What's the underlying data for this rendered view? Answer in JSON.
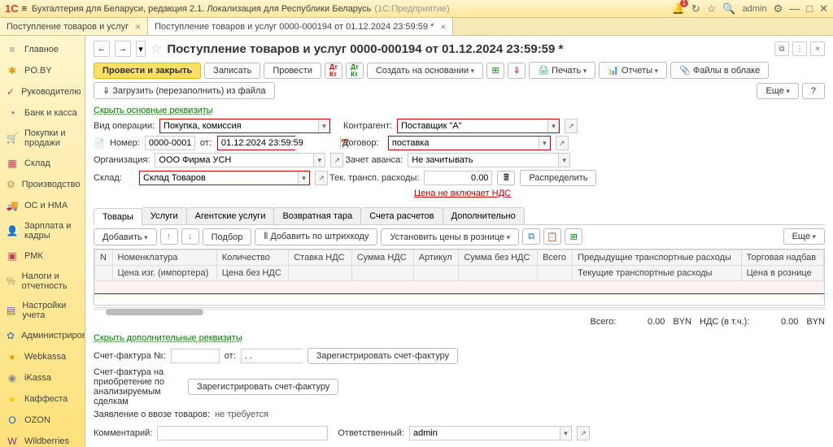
{
  "titlebar": {
    "logo": "1С",
    "menu": "≡",
    "title": "Бухгалтерия для Беларуси, редакция 2.1. Локализация для Республики Беларусь",
    "app": "(1С:Предприятие)",
    "user": "admin"
  },
  "tabs": [
    {
      "label": "Поступление товаров и услуг",
      "active": false
    },
    {
      "label": "Поступление товаров и услуг 0000-000194 от 01.12.2024 23:59:59 *",
      "active": true
    }
  ],
  "sidebar": [
    {
      "icon": "≡",
      "label": "Главное",
      "color": "#888"
    },
    {
      "icon": "✱",
      "label": "PO.BY",
      "color": "#e89b00"
    },
    {
      "icon": "✓",
      "label": "Руководителю",
      "color": "#c4395f"
    },
    {
      "icon": "◔",
      "label": "Банк и касса",
      "color": "#c4395f"
    },
    {
      "icon": "🛒",
      "label": "Покупки и продажи",
      "color": "#c4395f"
    },
    {
      "icon": "▦",
      "label": "Склад",
      "color": "#c4395f"
    },
    {
      "icon": "⚙",
      "label": "Производство",
      "color": "#b8935c"
    },
    {
      "icon": "🚚",
      "label": "ОС и НМА",
      "color": "#5c8ab8"
    },
    {
      "icon": "👤",
      "label": "Зарплата и кадры",
      "color": "#b8935c"
    },
    {
      "icon": "▣",
      "label": "РМК",
      "color": "#c4395f"
    },
    {
      "icon": "%",
      "label": "Налоги и отчетность",
      "color": "#b8935c"
    },
    {
      "icon": "▤",
      "label": "Настройки учета",
      "color": "#6a5cb8"
    },
    {
      "icon": "✿",
      "label": "Администрирование",
      "color": "#5c8ab8"
    },
    {
      "icon": "●",
      "label": "Webkassa",
      "color": "#e89b00"
    },
    {
      "icon": "◉",
      "label": "iKassa",
      "color": "#888"
    },
    {
      "icon": "●",
      "label": "Каффеста",
      "color": "#f0d000"
    },
    {
      "icon": "O",
      "label": "OZON",
      "color": "#0066cc"
    },
    {
      "icon": "W",
      "label": "Wildberries",
      "color": "#7b2d8e"
    }
  ],
  "page": {
    "title": "Поступление товаров и услуг 0000-000194 от 01.12.2024 23:59:59 *"
  },
  "toolbar": {
    "post_close": "Провести и закрыть",
    "write": "Записать",
    "post": "Провести",
    "create_based": "Создать на основании",
    "print": "Печать",
    "reports": "Отчеты",
    "cloud": "Файлы в облаке",
    "load": "Загрузить (перезаполнить) из файла",
    "more": "Еще",
    "help": "?"
  },
  "link_hide": "Скрыть основные реквизиты",
  "form": {
    "op_type_label": "Вид операции:",
    "op_type": "Покупка, комиссия",
    "counterparty_label": "Контрагент:",
    "counterparty": "Поставщик \"А\"",
    "number_label": "Номер:",
    "number": "0000-000194",
    "from_label": "от:",
    "date": "01.12.2024 23:59:59",
    "contract_label": "Договор:",
    "contract": "поставка",
    "org_label": "Организация:",
    "org": "ООО Фирма УСН",
    "advance_label": "Зачет аванса:",
    "advance": "Не зачитывать",
    "warehouse_label": "Склад:",
    "warehouse": "Склад Товаров",
    "transport_label": "Тек. трансп. расходы:",
    "transport": "0.00",
    "distribute": "Распределить",
    "vat_link": "Цена не включает НДС"
  },
  "doc_tabs": [
    "Товары",
    "Услуги",
    "Агентские услуги",
    "Возвратная тара",
    "Счета расчетов",
    "Дополнительно"
  ],
  "table_toolbar": {
    "add": "Добавить",
    "pick": "Подбор",
    "barcode": "Добавить по штрихкоду",
    "retail_prices": "Установить цены в рознице",
    "more": "Еще"
  },
  "columns": {
    "row1": [
      "N",
      "Номенклатура",
      "Количество",
      "Ставка НДС",
      "Сумма НДС",
      "Артикул",
      "Сумма без НДС",
      "Всего",
      "Предыдущие транспортные расходы",
      "Торговая надбав"
    ],
    "row2": [
      "",
      "Цена изг. (импортера)",
      "Цена без НДС",
      "",
      "",
      "",
      "",
      "",
      "Текущие транспортные расходы",
      "Цена в рознице"
    ]
  },
  "totals": {
    "total_label": "Всего:",
    "total": "0.00",
    "currency": "BYN",
    "vat_label": "НДС (в т.ч.):",
    "vat": "0.00"
  },
  "link_add": "Скрыть дополнительные реквизиты",
  "footer": {
    "invoice_label": "Счет-фактура №:",
    "from": "от:",
    "date_mask": ". .",
    "reg_invoice": "Зарегистрировать счет-фактуру",
    "acq_invoice_label": "Счет-фактура на приобретение по анализируемым сделкам",
    "reg_invoice2": "Зарегистрировать счет-фактуру",
    "import_label": "Заявление о ввозе товаров:",
    "import_val": "не требуется",
    "comment_label": "Комментарий:",
    "responsible_label": "Ответственный:",
    "responsible": "admin"
  }
}
